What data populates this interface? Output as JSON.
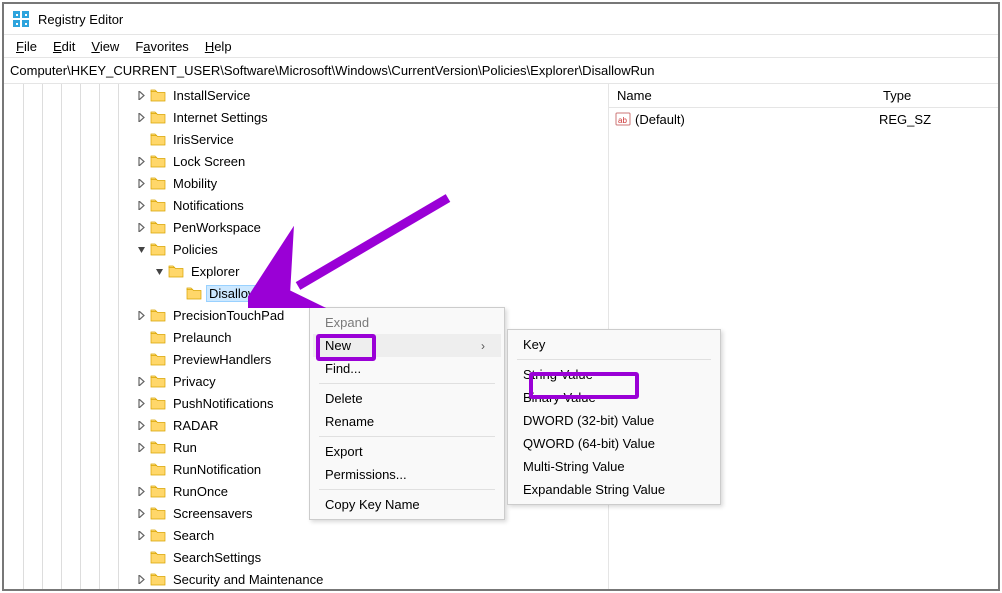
{
  "titlebar": {
    "title": "Registry Editor"
  },
  "menubar": {
    "file": "File",
    "edit": "Edit",
    "view": "View",
    "favorites": "Favorites",
    "help": "Help"
  },
  "address": "Computer\\HKEY_CURRENT_USER\\Software\\Microsoft\\Windows\\CurrentVersion\\Policies\\Explorer\\DisallowRun",
  "tree": {
    "items": [
      {
        "indent": 130,
        "exp": ">",
        "label": "InstallService"
      },
      {
        "indent": 130,
        "exp": ">",
        "label": "Internet Settings"
      },
      {
        "indent": 130,
        "exp": "",
        "label": "IrisService"
      },
      {
        "indent": 130,
        "exp": ">",
        "label": "Lock Screen"
      },
      {
        "indent": 130,
        "exp": ">",
        "label": "Mobility"
      },
      {
        "indent": 130,
        "exp": ">",
        "label": "Notifications"
      },
      {
        "indent": 130,
        "exp": ">",
        "label": "PenWorkspace"
      },
      {
        "indent": 130,
        "exp": "v",
        "label": "Policies"
      },
      {
        "indent": 148,
        "exp": "v",
        "label": "Explorer"
      },
      {
        "indent": 166,
        "exp": "",
        "label": "DisallowRun",
        "selected": true
      },
      {
        "indent": 130,
        "exp": ">",
        "label": "PrecisionTouchPad"
      },
      {
        "indent": 130,
        "exp": "",
        "label": "Prelaunch"
      },
      {
        "indent": 130,
        "exp": "",
        "label": "PreviewHandlers"
      },
      {
        "indent": 130,
        "exp": ">",
        "label": "Privacy"
      },
      {
        "indent": 130,
        "exp": ">",
        "label": "PushNotifications"
      },
      {
        "indent": 130,
        "exp": ">",
        "label": "RADAR"
      },
      {
        "indent": 130,
        "exp": ">",
        "label": "Run"
      },
      {
        "indent": 130,
        "exp": "",
        "label": "RunNotification"
      },
      {
        "indent": 130,
        "exp": ">",
        "label": "RunOnce"
      },
      {
        "indent": 130,
        "exp": ">",
        "label": "Screensavers"
      },
      {
        "indent": 130,
        "exp": ">",
        "label": "Search"
      },
      {
        "indent": 130,
        "exp": "",
        "label": "SearchSettings"
      },
      {
        "indent": 130,
        "exp": ">",
        "label": "Security and Maintenance"
      }
    ]
  },
  "values": {
    "header": {
      "name": "Name",
      "type": "Type"
    },
    "rows": [
      {
        "name": "(Default)",
        "type": "REG_SZ"
      }
    ]
  },
  "context1": {
    "items": [
      {
        "label": "Expand",
        "disabled": true
      },
      {
        "label": "New",
        "hover": true,
        "submenu": true
      },
      {
        "label": "Find..."
      },
      {
        "sep": true
      },
      {
        "label": "Delete"
      },
      {
        "label": "Rename"
      },
      {
        "sep": true
      },
      {
        "label": "Export"
      },
      {
        "label": "Permissions..."
      },
      {
        "sep": true
      },
      {
        "label": "Copy Key Name"
      }
    ]
  },
  "context2": {
    "items": [
      {
        "label": "Key"
      },
      {
        "sep": true
      },
      {
        "label": "String Value"
      },
      {
        "label": "Binary Value"
      },
      {
        "label": "DWORD (32-bit) Value"
      },
      {
        "label": "QWORD (64-bit) Value"
      },
      {
        "label": "Multi-String Value"
      },
      {
        "label": "Expandable String Value"
      }
    ]
  }
}
